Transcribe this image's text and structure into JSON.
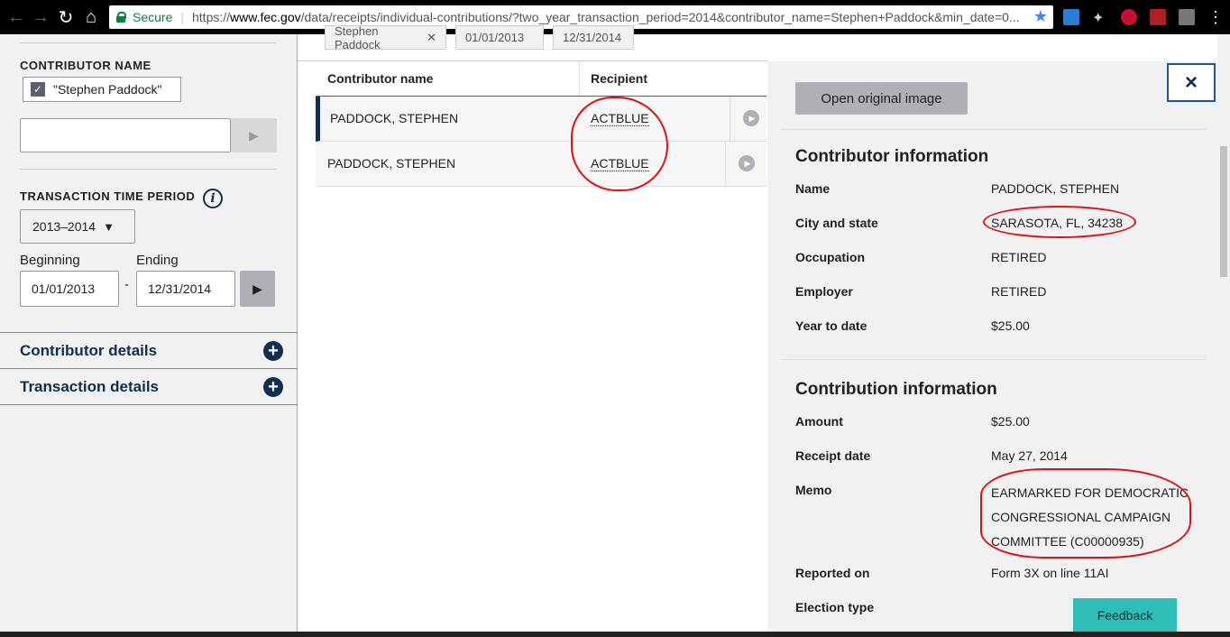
{
  "browser": {
    "secure_label": "Secure",
    "url_scheme": "https://",
    "url_host": "www.fec.gov",
    "url_path": "/data/receipts/individual-contributions/?two_year_transaction_period=2014&contributor_name=Stephen+Paddock&min_date=0..."
  },
  "sidebar": {
    "contributor_name_heading": "CONTRIBUTOR NAME",
    "contributor_chip": "\"Stephen Paddock\"",
    "name_input_value": "",
    "period_heading": "TRANSACTION TIME PERIOD",
    "period_select_value": "2013–2014",
    "beginning_label": "Beginning",
    "ending_label": "Ending",
    "date_separator": "-",
    "beginning_value": "01/01/2013",
    "ending_value": "12/31/2014",
    "accordions": [
      "Contributor details",
      "Transaction details"
    ]
  },
  "filter_tags": [
    "Stephen Paddock",
    "01/01/2013",
    "12/31/2014"
  ],
  "table": {
    "columns": [
      "Contributor name",
      "Recipient"
    ],
    "rows": [
      {
        "contributor": "PADDOCK, STEPHEN",
        "recipient": "ACTBLUE"
      },
      {
        "contributor": "PADDOCK, STEPHEN",
        "recipient": "ACTBLUE"
      }
    ]
  },
  "panel": {
    "open_image_label": "Open original image",
    "close_label": "×",
    "contributor_title": "Contributor information",
    "contributor_fields": [
      {
        "key": "Name",
        "value": "PADDOCK, STEPHEN"
      },
      {
        "key": "City and state",
        "value": "SARASOTA, FL, 34238"
      },
      {
        "key": "Occupation",
        "value": "RETIRED"
      },
      {
        "key": "Employer",
        "value": "RETIRED"
      },
      {
        "key": "Year to date",
        "value": "$25.00"
      }
    ],
    "contribution_title": "Contribution information",
    "contribution_fields": [
      {
        "key": "Amount",
        "value": "$25.00"
      },
      {
        "key": "Receipt date",
        "value": "May 27, 2014"
      },
      {
        "key": "Memo",
        "value": ""
      },
      {
        "key": "Reported on",
        "value": "Form 3X on line 11AI"
      },
      {
        "key": "Election type",
        "value": ""
      }
    ],
    "memo_lines": [
      "EARMARKED FOR DEMOCRATIC",
      "CONGRESSIONAL CAMPAIGN",
      "COMMITTEE (C00000935)"
    ]
  },
  "feedback_label": "Feedback",
  "colors": {
    "annotation_red": "#e01010",
    "fec_navy": "#112e51",
    "feedback_teal": "#2dbeb7"
  }
}
